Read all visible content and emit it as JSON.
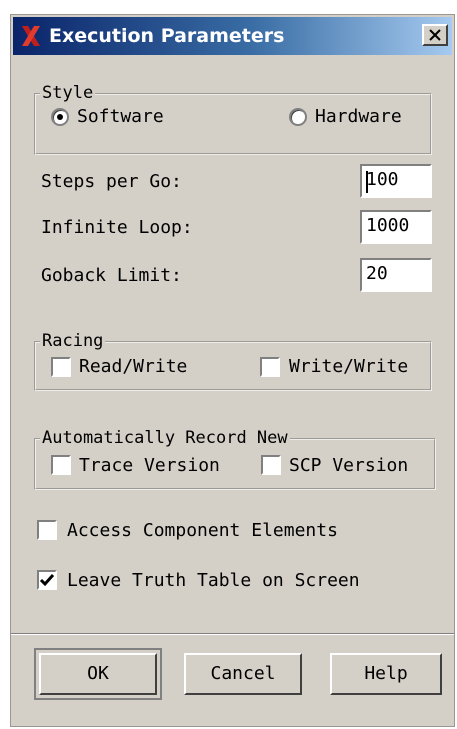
{
  "window": {
    "title": "Execution Parameters",
    "logo_icon": "x-logo-icon",
    "close_icon": "close-icon"
  },
  "style_group": {
    "legend": "Style",
    "options": [
      "Software",
      "Hardware"
    ],
    "selected": "Software"
  },
  "fields": [
    {
      "label": "Steps per Go:",
      "value": "100"
    },
    {
      "label": "Infinite Loop:",
      "value": "1000"
    },
    {
      "label": "Goback Limit:",
      "value": "20"
    }
  ],
  "racing_group": {
    "legend": "Racing",
    "options": [
      {
        "label": "Read/Write",
        "checked": false
      },
      {
        "label": "Write/Write",
        "checked": false
      }
    ]
  },
  "record_group": {
    "legend": "Automatically Record New",
    "options": [
      {
        "label": "Trace Version",
        "checked": false
      },
      {
        "label": "SCP Version",
        "checked": false
      }
    ]
  },
  "toggles": [
    {
      "label": "Access Component Elements",
      "checked": false
    },
    {
      "label": "Leave Truth Table on Screen",
      "checked": true
    }
  ],
  "buttons": {
    "ok": "OK",
    "cancel": "Cancel",
    "help": "Help"
  }
}
